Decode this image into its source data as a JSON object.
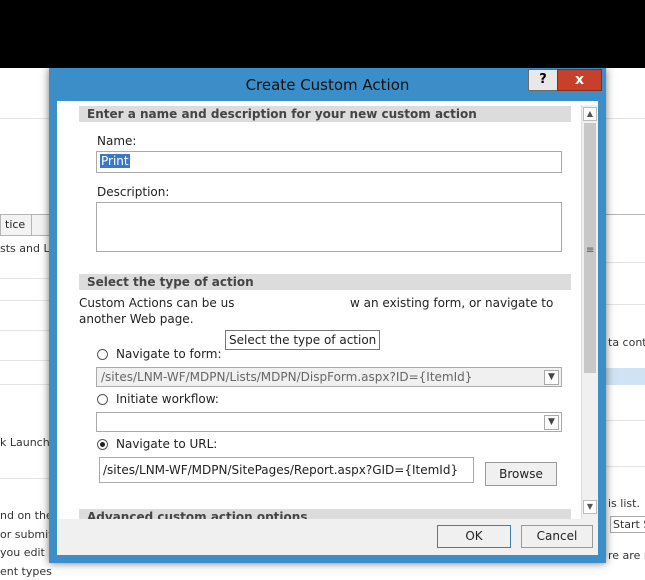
{
  "background": {
    "left_items": [
      "tice",
      "sts and Li",
      "k Launch",
      "nd on the",
      "or submitt",
      "you edit a",
      "ent types"
    ],
    "right_items": [
      "ta cont",
      "is list.",
      "Start Se",
      "re are r"
    ]
  },
  "dialog": {
    "title": "Create Custom Action",
    "help_label": "?",
    "close_label": "x",
    "section1_heading": "Enter a name and description for your new custom action",
    "name_label": "Name:",
    "name_value": "Print",
    "description_label": "Description:",
    "description_value": "",
    "section2_heading": "Select the type of action",
    "intro_part1": "Custom Actions can be us",
    "intro_part2": "w an existing form, or navigate to",
    "intro_line2": "another Web page.",
    "tooltip": "Select the type of action",
    "options": {
      "navigate_form": {
        "label": "Navigate to form:",
        "value": "/sites/LNM-WF/MDPN/Lists/MDPN/DispForm.aspx?ID={ItemId}",
        "selected": false
      },
      "workflow": {
        "label": "Initiate workflow:",
        "value": "",
        "selected": false
      },
      "navigate_url": {
        "label": "Navigate to URL:",
        "value": "/sites/LNM-WF/MDPN/SitePages/Report.aspx?GID={ItemId}",
        "selected": true
      }
    },
    "browse_label": "Browse",
    "section3_heading": "Advanced custom action options",
    "ok_label": "OK",
    "cancel_label": "Cancel"
  }
}
